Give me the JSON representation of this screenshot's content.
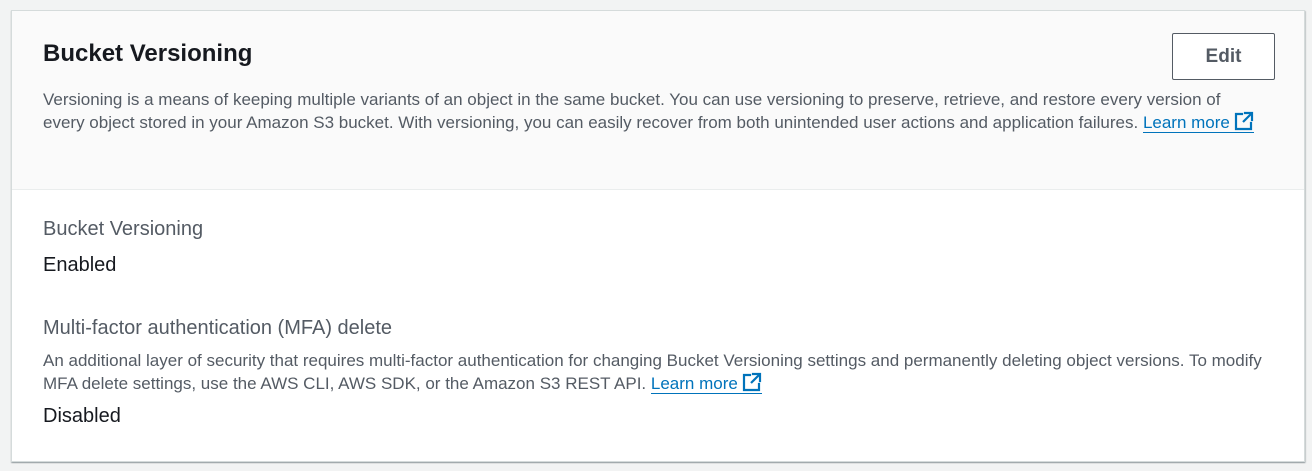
{
  "header": {
    "title": "Bucket Versioning",
    "edit_label": "Edit",
    "description": "Versioning is a means of keeping multiple variants of an object in the same bucket. You can use versioning to preserve, retrieve, and restore every version of every object stored in your Amazon S3 bucket. With versioning, you can easily recover from both unintended user actions and application failures. ",
    "learn_more": "Learn more",
    "learn_more_icon": "external-link-icon"
  },
  "versioning": {
    "label": "Bucket Versioning",
    "value": "Enabled"
  },
  "mfa_delete": {
    "label": "Multi-factor authentication (MFA) delete",
    "description": "An additional layer of security that requires multi-factor authentication for changing Bucket Versioning settings and permanently deleting object versions. To modify MFA delete settings, use the AWS CLI, AWS SDK, or the Amazon S3 REST API. ",
    "learn_more": "Learn more",
    "learn_more_icon": "external-link-icon",
    "value": "Disabled"
  },
  "colors": {
    "link": "#0073bb",
    "text_primary": "#16191f",
    "text_secondary": "#545b64",
    "header_background": "#fafafa",
    "page_background": "#f2f3f3"
  }
}
